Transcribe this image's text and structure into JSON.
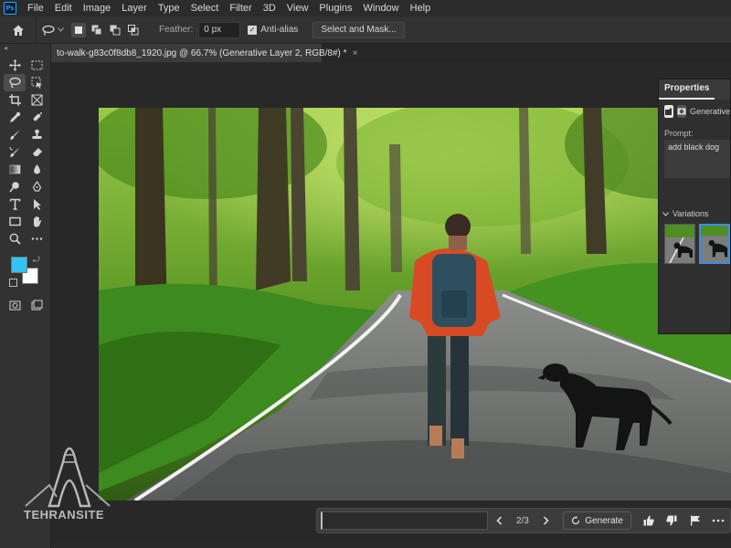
{
  "app": {
    "logo": "Ps"
  },
  "menu": [
    "File",
    "Edit",
    "Image",
    "Layer",
    "Type",
    "Select",
    "Filter",
    "3D",
    "View",
    "Plugins",
    "Window",
    "Help"
  ],
  "options": {
    "feather_label": "Feather:",
    "feather_value": "0 px",
    "antialias_label": "Anti-alias",
    "antialias_checked": true,
    "select_mask_label": "Select and Mask..."
  },
  "document": {
    "tab_title": "to-walk-g83c0f8db8_1920.jpg @ 66.7% (Generative Layer 2, RGB/8#) *",
    "close": "×"
  },
  "properties": {
    "tab": "Properties",
    "layer_name": "Generative",
    "prompt_label": "Prompt:",
    "prompt_value": "add black dog",
    "variations_label": "Variations"
  },
  "taskbar": {
    "counter": "2/3",
    "generate_label": "Generate"
  },
  "toolbar": {
    "tools": [
      "move-icon",
      "marquee-icon",
      "lasso-icon",
      "object-select-icon",
      "crop-icon",
      "frame-icon",
      "eyedropper-icon",
      "spot-heal-icon",
      "brush-icon",
      "stamp-icon",
      "history-brush-icon",
      "eraser-icon",
      "gradient-icon",
      "blur-icon",
      "dodge-icon",
      "pen-icon",
      "type-icon",
      "path-select-icon",
      "rectangle-icon",
      "hand-icon",
      "zoom-icon",
      "more-icon"
    ],
    "foreground_color": "#31c4f3",
    "background_color": "#ffffff"
  },
  "watermark": {
    "text": "TEHRANSITE"
  }
}
